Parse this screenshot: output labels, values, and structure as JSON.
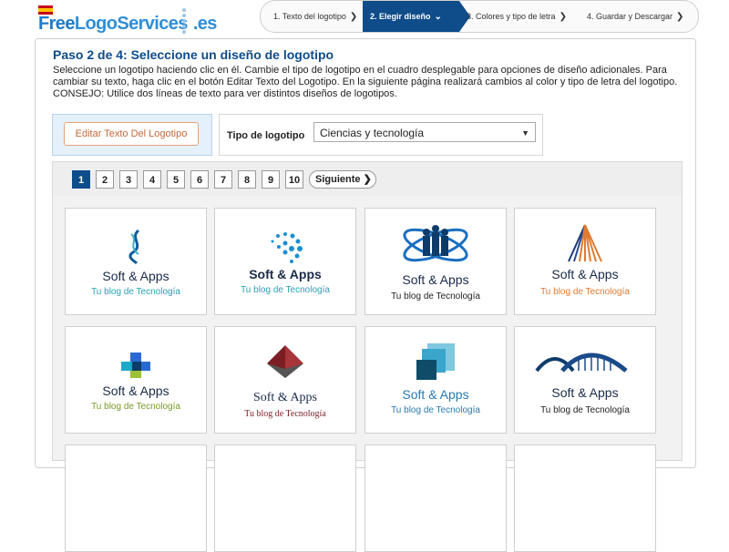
{
  "brand": {
    "name_a": "Free",
    "name_b": "LogoServices",
    "name_c": ".es"
  },
  "steps": [
    {
      "label": "1. Texto del logotipo"
    },
    {
      "label": "2. Elegir diseño"
    },
    {
      "label": "3. Colores y tipo de letra"
    },
    {
      "label": "4. Guardar y Descargar"
    }
  ],
  "heading": "Paso 2 de 4: Seleccione un diseño de logotipo",
  "instructions": "Seleccione un logotipo haciendo clic en él. Cambie el tipo de logotipo en el cuadro desplegable para opciones de diseño adicionales. Para cambiar su texto, haga clic en el botón Editar Texto del Logotipo. En la siguiente página realizará cambios al color y tipo de letra del logotipo. CONSEJO: Utilice dos líneas de texto para ver distintos diseños de logotipos.",
  "edit_button": "Editar Texto Del Logotipo",
  "type_label": "Tipo de logotipo",
  "type_value": "Ciencias y tecnología",
  "pager": {
    "pages": [
      "1",
      "2",
      "3",
      "4",
      "5",
      "6",
      "7",
      "8",
      "9",
      "10"
    ],
    "next": "Siguiente"
  },
  "logo_title": "Soft & Apps",
  "logo_sub": "Tu blog de Tecnología",
  "colors": {
    "brand": "#0e4c8a",
    "accent_orange": "#e07a2e",
    "teal": "#2aa0b5"
  }
}
